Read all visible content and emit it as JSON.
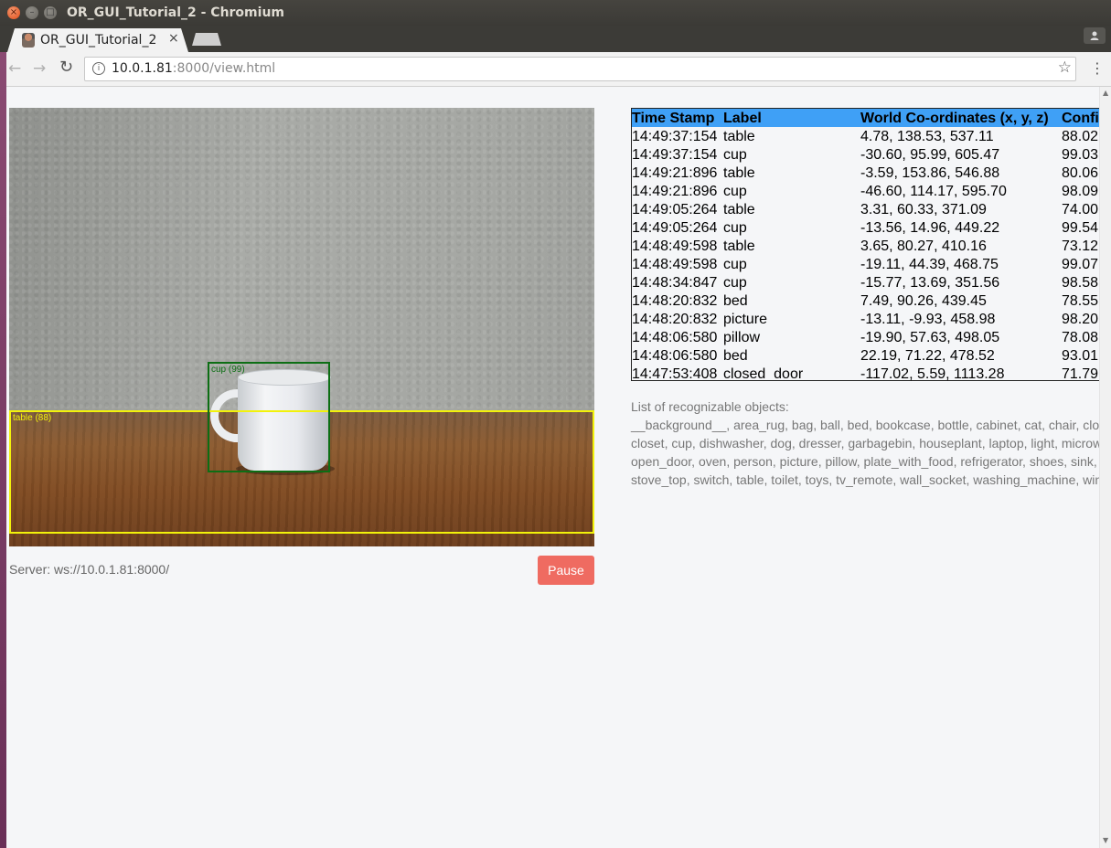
{
  "window": {
    "title": "OR_GUI_Tutorial_2 - Chromium",
    "close_glyph": "×",
    "min_glyph": "–",
    "max_glyph": "□"
  },
  "tab": {
    "title": "OR_GUI_Tutorial_2",
    "close_glyph": "×"
  },
  "toolbar": {
    "back_glyph": "←",
    "forward_glyph": "→",
    "reload_glyph": "↻",
    "url_host": "10.0.1.81",
    "url_rest": ":8000/view.html",
    "star_glyph": "☆",
    "menu_glyph": "⋮",
    "info_glyph": "i"
  },
  "camera": {
    "detections": [
      {
        "label": "cup (99)"
      },
      {
        "label": "table (88)"
      }
    ]
  },
  "footer": {
    "server_text": "Server: ws://10.0.1.81:8000/",
    "pause_label": "Pause"
  },
  "results": {
    "headers": [
      "Time Stamp",
      "Label",
      "World Co-ordinates (x, y, z)",
      "Confidence"
    ],
    "rows": [
      [
        "14:49:37:154",
        "table",
        "4.78, 138.53, 537.11",
        "88.02"
      ],
      [
        "14:49:37:154",
        "cup",
        "-30.60, 95.99, 605.47",
        "99.03"
      ],
      [
        "14:49:21:896",
        "table",
        "-3.59, 153.86, 546.88",
        "80.06"
      ],
      [
        "14:49:21:896",
        "cup",
        "-46.60, 114.17, 595.70",
        "98.09"
      ],
      [
        "14:49:05:264",
        "table",
        "3.31, 60.33, 371.09",
        "74.00"
      ],
      [
        "14:49:05:264",
        "cup",
        "-13.56, 14.96, 449.22",
        "99.54"
      ],
      [
        "14:48:49:598",
        "table",
        "3.65, 80.27, 410.16",
        "73.12"
      ],
      [
        "14:48:49:598",
        "cup",
        "-19.11, 44.39, 468.75",
        "99.07"
      ],
      [
        "14:48:34:847",
        "cup",
        "-15.77, 13.69, 351.56",
        "98.58"
      ],
      [
        "14:48:20:832",
        "bed",
        "7.49, 90.26, 439.45",
        "78.55"
      ],
      [
        "14:48:20:832",
        "picture",
        "-13.11, -9.93, 458.98",
        "98.20"
      ],
      [
        "14:48:06:580",
        "pillow",
        "-19.90, 57.63, 498.05",
        "78.08"
      ],
      [
        "14:48:06:580",
        "bed",
        "22.19, 71.22, 478.52",
        "93.01"
      ],
      [
        "14:47:53:408",
        "closed_door",
        "-117.02, 5.59, 1113.28",
        "71.79"
      ]
    ]
  },
  "objects": {
    "title": "List of recognizable objects:",
    "lines": [
      "__background__, area_rug, bag, ball, bed, bookcase, bottle, cabinet, cat, chair, clo",
      "closet, cup, dishwasher, dog, dresser, garbagebin, houseplant, laptop, light, microw",
      "open_door, oven, person, picture, pillow, plate_with_food, refrigerator, shoes, sink,",
      "stove_top, switch, table, toilet, toys, tv_remote, wall_socket, washing_machine, win"
    ]
  }
}
